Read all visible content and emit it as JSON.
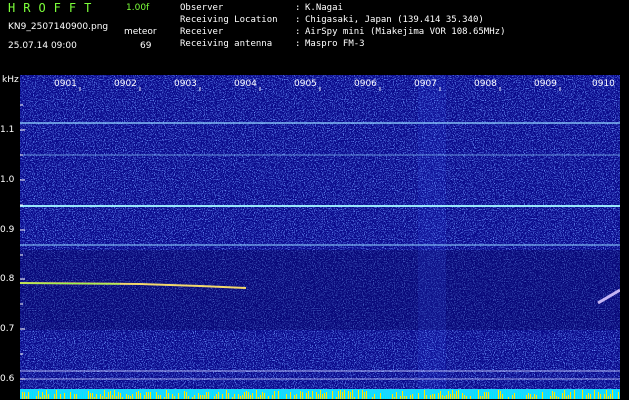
{
  "header": {
    "brand": "HROFFT",
    "version": "1.00f",
    "filename": "KN9_2507140900.png",
    "meteor_label": "meteor",
    "datetime": "25.07.14 09:00",
    "meteor_count": "69",
    "meta": [
      {
        "key": "Observer",
        "value": "K.Nagai"
      },
      {
        "key": "Receiving Location",
        "value": "Chigasaki, Japan (139.414 35.340)"
      },
      {
        "key": "Receiver",
        "value": "AirSpy mini (Miakejima VOR 108.65MHz)"
      },
      {
        "key": "Receiving antenna",
        "value": "Maspro FM-3"
      }
    ]
  },
  "spectrogram": {
    "y_unit": "kHz",
    "y_ticks": [
      "1.1",
      "1.0",
      "0.9",
      "0.8",
      "0.7",
      "0.6"
    ],
    "x_ticks": [
      "0901",
      "0902",
      "0903",
      "0904",
      "0905",
      "0906",
      "0907",
      "0908",
      "0909",
      "0910"
    ],
    "colors": {
      "background": "#0a0a8c",
      "noise": "#3050ff",
      "line": "#8fd0ff",
      "meteor": "#ffe36a",
      "header_text": "#7cff3a"
    }
  }
}
